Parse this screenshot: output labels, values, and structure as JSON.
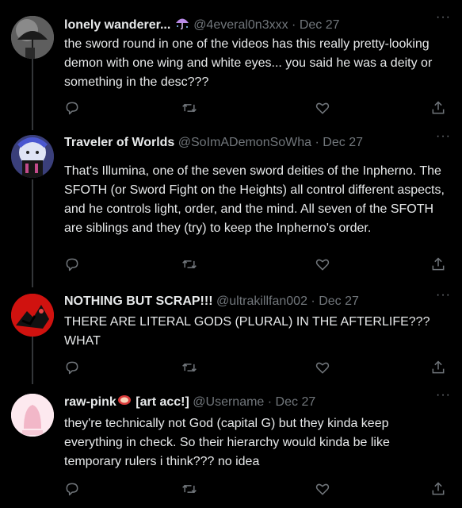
{
  "icons": {
    "reply": "reply-icon",
    "retweet": "retweet-icon",
    "like": "heart-icon",
    "share": "share-icon",
    "more": "more-icon"
  },
  "more_glyph": "···",
  "dot": " · ",
  "tweets": [
    {
      "name": "lonely wanderer...",
      "handle": "@4everal0n3xxx",
      "date": "Dec 27",
      "text": "the sword round in one of the videos has this really pretty-looking demon with one wing and white eyes... you said he was a deity or something in the desc???"
    },
    {
      "name": "Traveler of Worlds",
      "handle": "@SoImADemonSoWha",
      "date": "Dec 27",
      "text": "That's Illumina, one of the seven sword deities of the Inpherno. The SFOTH (or Sword Fight on the Heights) all control different aspects, and he controls light, order, and the mind. All seven of the SFOTH are siblings and they (try) to keep the Inpherno's order."
    },
    {
      "name": "NOTHING BUT SCRAP!!!",
      "handle": "@ultrakillfan002",
      "date": "Dec 27",
      "text": "THERE ARE LITERAL GODS (PLURAL) IN THE AFTERLIFE??? WHAT"
    },
    {
      "name": "raw-pink",
      "name_suffix": " [art acc!]",
      "handle": "@Username",
      "date": "Dec 27",
      "text": "they're technically not God (capital G) but they kinda keep everything in check. So their hierarchy would kinda be like temporary rulers i think??? no idea"
    }
  ]
}
